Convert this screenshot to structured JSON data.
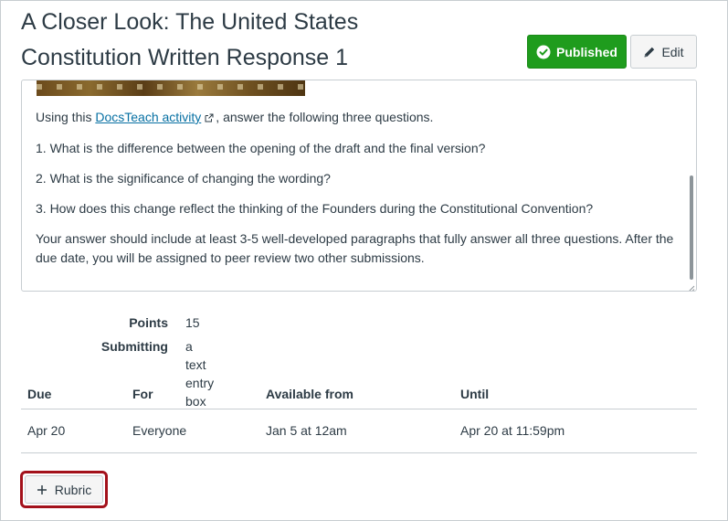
{
  "page": {
    "title_line1": "A Closer Look: The United States",
    "title_line2": "Constitution Written Response 1"
  },
  "toolbar": {
    "published_label": "Published",
    "edit_label": "Edit"
  },
  "description": {
    "intro_prefix": "Using this ",
    "intro_link": "DocsTeach activity",
    "intro_suffix": ", answer the following three questions.",
    "q1": "1. What is the difference between the opening of the draft and the final version?",
    "q2": "2. What is the significance of changing the wording?",
    "q3": "3. How does this change reflect the thinking of the Founders during the Constitutional Convention?",
    "closing": "Your answer should include at least 3-5 well-developed paragraphs that fully answer all three questions. After the due date, you will be assigned to peer review two other submissions."
  },
  "details": {
    "points_label": "Points",
    "points_value": "15",
    "submitting_label": "Submitting",
    "submitting_value": "a text entry box"
  },
  "dates": {
    "headers": [
      "Due",
      "For",
      "Available from",
      "Until"
    ],
    "rows": [
      [
        "Apr 20",
        "Everyone",
        "Jan 5 at 12am",
        "Apr 20 at 11:59pm"
      ]
    ]
  },
  "rubric": {
    "button_label": "Rubric"
  },
  "colors": {
    "published_green": "#1f9c1d",
    "link_blue": "#0770a3",
    "highlight_red": "#a3111b"
  }
}
